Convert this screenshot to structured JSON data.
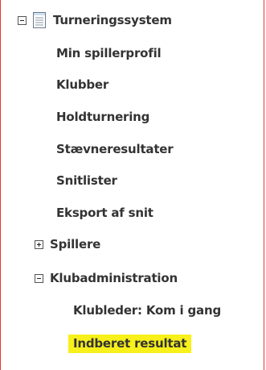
{
  "tree": {
    "root": {
      "label": "Turneringssystem",
      "expanded": true,
      "icon": "document-icon"
    },
    "items": [
      {
        "label": "Min spillerprofil"
      },
      {
        "label": "Klubber"
      },
      {
        "label": "Holdturnering"
      },
      {
        "label": "Stævneresultater"
      },
      {
        "label": "Snitlister"
      },
      {
        "label": "Eksport af snit"
      }
    ],
    "spillere": {
      "label": "Spillere",
      "expanded": false
    },
    "klubadmin": {
      "label": "Klubadministration",
      "expanded": true,
      "children": [
        {
          "label": "Klubleder: Kom i gang"
        },
        {
          "label": "Indberet resultat",
          "highlighted": true
        }
      ]
    }
  },
  "colors": {
    "frame_border": "#e53935",
    "highlight": "#f7f01a",
    "text": "#333333"
  }
}
